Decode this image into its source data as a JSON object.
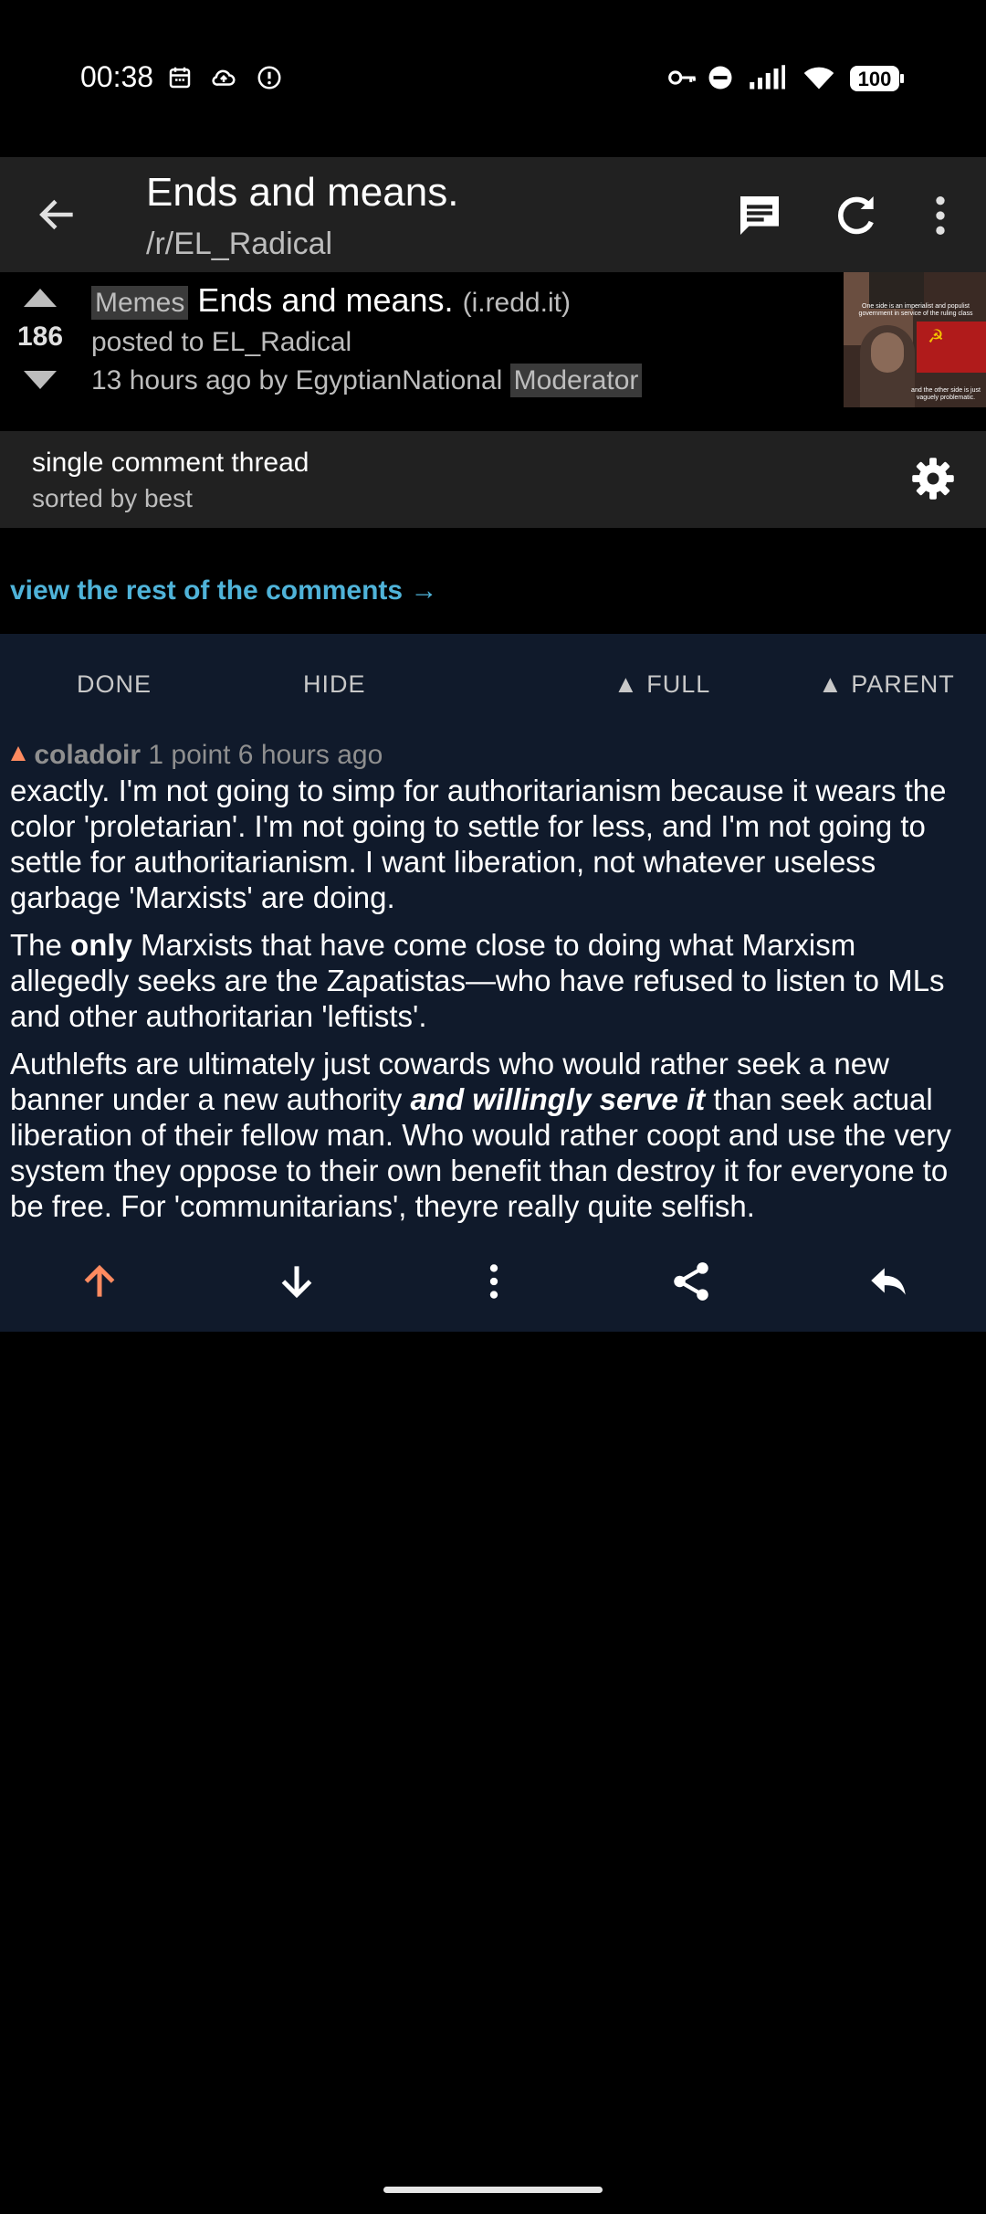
{
  "status_bar": {
    "time": "00:38",
    "battery": "100",
    "icons": [
      "calendar-icon",
      "cloud-upload-icon",
      "alert-circle-icon",
      "vpn-key-icon",
      "do-not-disturb-icon",
      "signal-icon",
      "wifi-icon",
      "battery-icon"
    ]
  },
  "app_bar": {
    "title": "Ends and means.",
    "subtitle": "/r/EL_Radical",
    "icons": [
      "back-arrow-icon",
      "comment-icon",
      "refresh-icon",
      "more-vertical-icon"
    ]
  },
  "post": {
    "score": "186",
    "flair": "Memes",
    "title": "Ends and means.",
    "domain": "(i.redd.it)",
    "posted_to": "posted to EL_Radical",
    "time_by": "13 hours ago by EgyptianNational",
    "author_tag": "Moderator",
    "thumbnail": {
      "top_caption": "One side is an imperialist and populist government in service of the ruling class",
      "bottom_caption": "and the other side is just vaguely problematic."
    }
  },
  "thread_bar": {
    "title": "single comment thread",
    "sort": "sorted by best"
  },
  "view_rest": "view the rest of the comments →",
  "comment_controls": {
    "done": "DONE",
    "hide": "HIDE",
    "full": "▲ FULL",
    "parent": "▲ PARENT"
  },
  "comment": {
    "author": "coladoir",
    "meta": "1 point 6 hours ago",
    "p1": "exactly. I'm not going to simp for authoritarianism because it wears the color 'proletarian'. I'm not going to settle for less, and I'm not going to settle for authoritarianism. I want liberation, not whatever useless garbage 'Marxists' are doing.",
    "p2_a": "The ",
    "p2_bold": "only",
    "p2_b": " Marxists that have come close to doing what Marxism allegedly seeks are the Zapatistas—who have refused to listen to MLs and other authoritarian 'leftists'.",
    "p3_a": "Authlefts are ultimately just cowards who would rather seek a new banner under a new authority ",
    "p3_em": "and willingly serve it",
    "p3_b": " than seek actual liberation of their fellow man. Who would rather coopt and use the very system they oppose to their own benefit than destroy it for everyone to be free. For 'communitarians', theyre really quite selfish."
  },
  "colors": {
    "upvote_accent": "#ff8b60",
    "link_blue": "#4fb3d9",
    "comment_bg": "#101a2b",
    "bar_bg": "#212121"
  }
}
